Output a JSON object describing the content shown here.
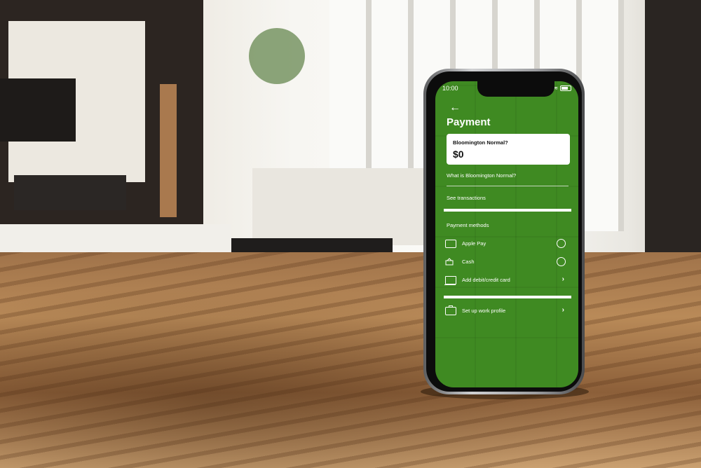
{
  "status_bar": {
    "time": "10:00"
  },
  "header": {
    "back_icon": "←",
    "title": "Payment"
  },
  "balance_card": {
    "label": "Bloomington Normal?",
    "amount": "$0"
  },
  "links": {
    "what_is": "What is Bloomington Normal?",
    "see_transactions": "See  transactions"
  },
  "payment_methods": {
    "section_title": "Payment methods",
    "items": [
      {
        "label": "Apple Pay",
        "icon": "apple-pay-icon"
      },
      {
        "label": "Cash",
        "icon": "cash-icon"
      },
      {
        "label": "Add debit/credit card",
        "icon": "card-icon"
      }
    ]
  },
  "work_profile": {
    "label": "Set up work profile",
    "icon": "briefcase-icon"
  },
  "colors": {
    "screen_green": "#3f8a22",
    "card_bg": "#ffffff",
    "text": "#ffffff"
  }
}
